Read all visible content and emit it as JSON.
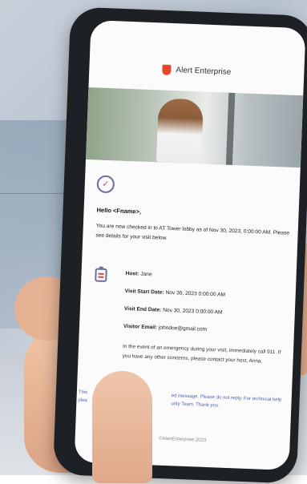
{
  "brand": {
    "name": "Alert Enterprise"
  },
  "email": {
    "greeting": "Hello <Fname>,",
    "intro": "You are now checked in to AT Tower lobby as of Nov 30, 2023, 0:00:00 AM. Please see details for your visit below.",
    "host_label": "Host:",
    "host_value": "Jane",
    "start_label": "Visit Start Date:",
    "start_value": "Nov 30, 2023 0:00:00 AM",
    "end_label": "Visit End Date:",
    "end_value": "Nov 30, 2023 0:00:00 AM",
    "email_label": "Visitor Email:",
    "email_value": "johndoe@gmail.com",
    "emergency": "In the event of an emergency during your visit, immediately call 911. If you have any other concerns, please contact your host, Anna.",
    "footer_left": "This",
    "footer_left2": "plea",
    "footer_right": "ed message. Please do not reply. For technical help",
    "footer_right2": "urity Team. Thank you.",
    "copyright": "©AlertEnterprise 2023"
  },
  "colors": {
    "accent": "#6d6f9c",
    "brand_red": "#e6462e",
    "link": "#5560b0"
  }
}
